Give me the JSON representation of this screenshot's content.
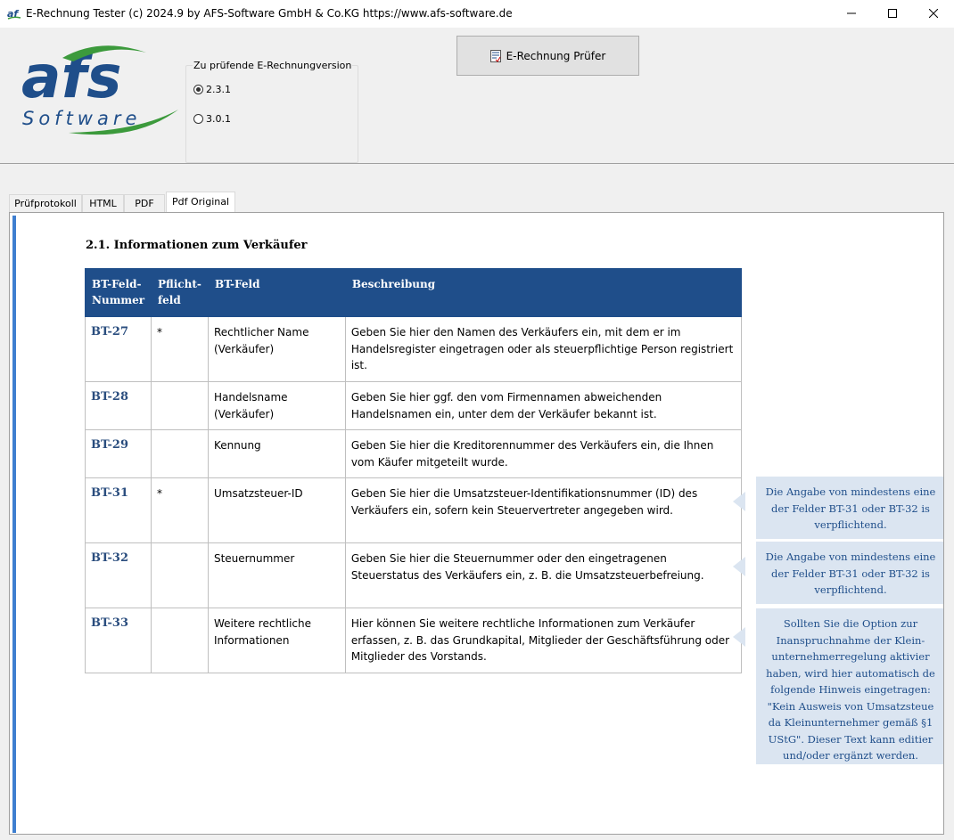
{
  "window": {
    "title": "E-Rechnung Tester (c) 2024.9 by AFS-Software GmbH & Co.KG  https://www.afs-software.de"
  },
  "logo": {
    "main": "afs",
    "sub": "Software"
  },
  "version_group": {
    "legend": "Zu prüfende E-Rechnungversion",
    "options": [
      {
        "label": "2.3.1",
        "checked": true
      },
      {
        "label": "3.0.1",
        "checked": false
      }
    ]
  },
  "pruefer_button": {
    "label": "E-Rechnung Prüfer"
  },
  "tabs": [
    {
      "label": "Prüfprotokoll"
    },
    {
      "label": "HTML"
    },
    {
      "label": "PDF"
    },
    {
      "label": "Pdf Original",
      "active": true
    }
  ],
  "document": {
    "heading": "2.1. Informationen zum Verkäufer",
    "columns": {
      "nummer_line1": "BT-Feld-",
      "nummer_line2": "Nummer",
      "pflicht_line1": "Pflicht-",
      "pflicht_line2": "feld",
      "feld": "BT-Feld",
      "beschreibung": "Beschreibung"
    },
    "rows": [
      {
        "code": "BT-27",
        "pflicht": "*",
        "feld": "Rechtlicher Name (Verkäufer)",
        "beschreibung": "Geben Sie hier den Namen des Verkäufers ein, mit dem er im Handelsregister eingetragen oder als steuerpflichtige Person registriert ist."
      },
      {
        "code": "BT-28",
        "pflicht": "",
        "feld": "Handelsname (Verkäufer)",
        "beschreibung": "Geben Sie hier ggf. den vom Firmennamen abweichenden Handelsnamen ein, unter dem der Verkäufer bekannt ist."
      },
      {
        "code": "BT-29",
        "pflicht": "",
        "feld": "Kennung",
        "beschreibung": "Geben Sie hier die Kreditorennummer des Verkäufers ein, die Ihnen vom Käufer mitgeteilt wurde."
      },
      {
        "code": "BT-31",
        "pflicht": "*",
        "feld": "Umsatzsteuer-ID",
        "beschreibung": "Geben Sie hier die Umsatzsteuer-Identifikationsnummer (ID) des Verkäufers ein, sofern kein Steuervertreter angegeben wird."
      },
      {
        "code": "BT-32",
        "pflicht": "",
        "feld": "Steuernummer",
        "beschreibung": "Geben Sie hier die Steuernummer oder den eingetragenen Steuerstatus des Verkäufers ein, z. B. die Umsatzsteuerbefreiung."
      },
      {
        "code": "BT-33",
        "pflicht": "",
        "feld": "Weitere rechtliche Informationen",
        "beschreibung": "Hier können Sie weitere rechtliche Informationen zum Verkäufer erfassen, z. B. das Grundkapital, Mitglieder der Geschäftsführung oder Mitglieder des Vorstands."
      }
    ],
    "callouts": [
      {
        "lines": [
          "Die Angabe von mindestens eine",
          "der Felder BT-31 oder BT-32 is",
          "verpflichtend."
        ]
      },
      {
        "lines": [
          "Die Angabe von mindestens eine",
          "der Felder BT-31 oder BT-32 is",
          "verpflichtend."
        ]
      },
      {
        "lines": [
          "Sollten Sie die Option zur",
          "Inanspruchnahme der Klein-",
          "unternehmerregelung aktivier",
          "haben, wird hier automatisch de",
          "folgende Hinweis eingetragen:",
          "\"Kein Ausweis von Umsatzsteue",
          "da Kleinunternehmer gemäß §1",
          "UStG\". Dieser Text kann editier",
          "und/oder ergänzt werden."
        ]
      }
    ]
  }
}
